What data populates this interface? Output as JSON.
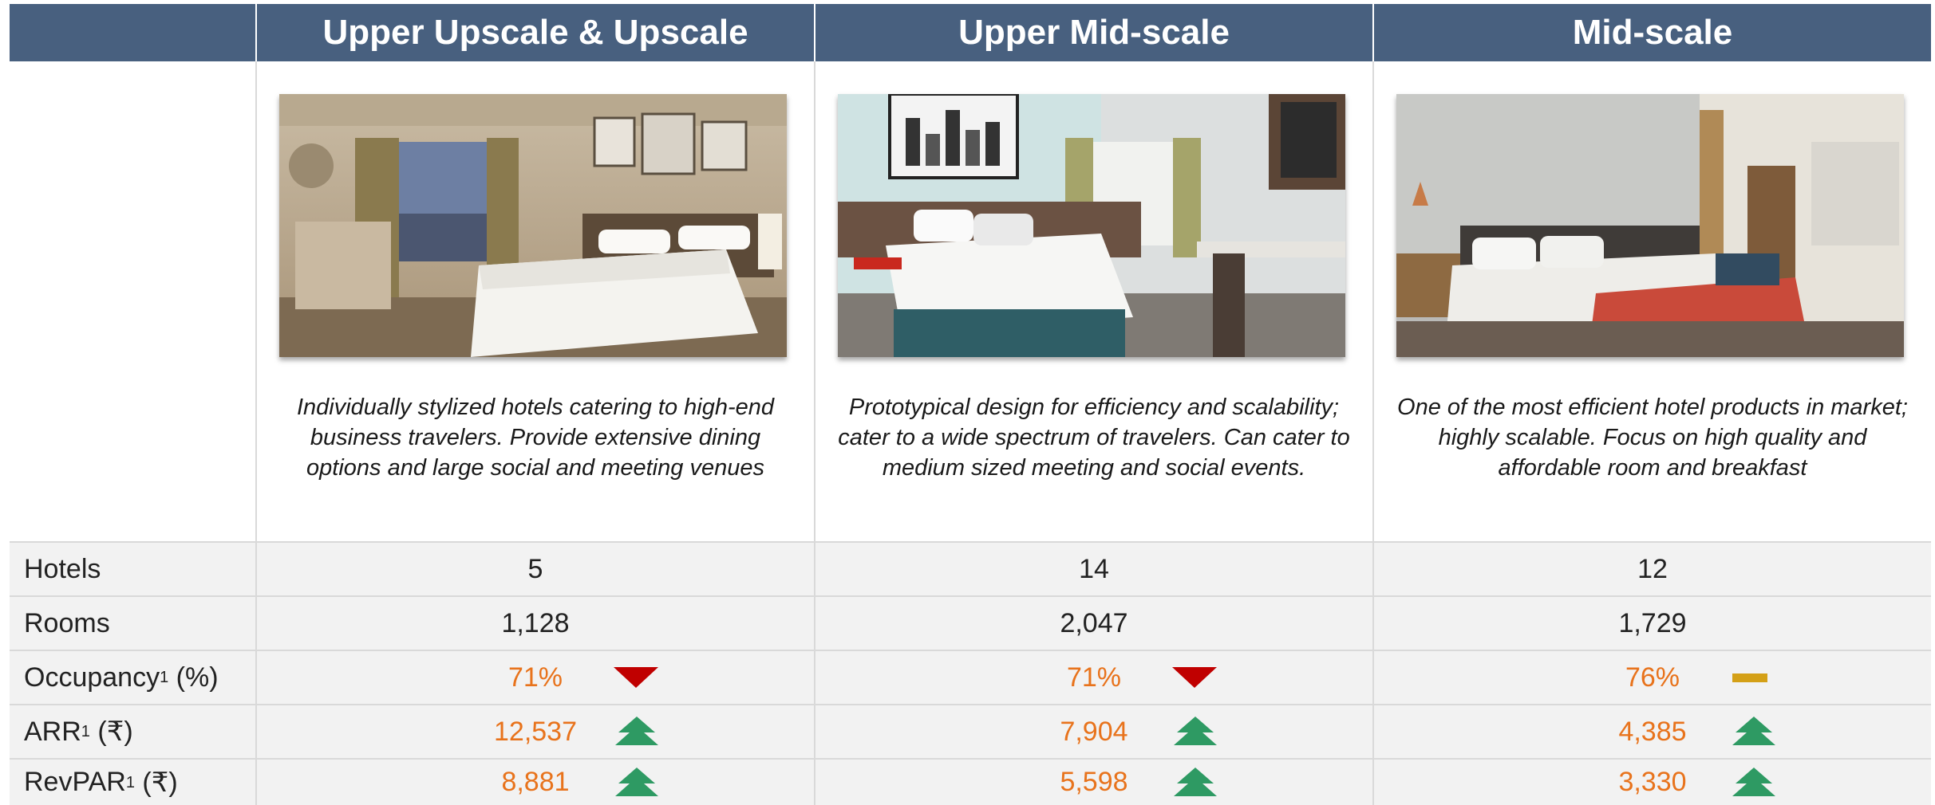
{
  "headers": [
    "Upper Upscale & Upscale",
    "Upper Mid-scale",
    "Mid-scale"
  ],
  "segments": [
    {
      "description": "Individually stylized hotels catering to high-end business travelers. Provide extensive dining options and large social and meeting venues",
      "hotels": "5",
      "rooms": "1,128",
      "occupancy": "71%",
      "arr": "12,537",
      "revpar": "8,881",
      "occupancy_trend": "down",
      "arr_trend": "up",
      "revpar_trend": "up"
    },
    {
      "description": "Prototypical design for efficiency and scalability; cater to a wide spectrum of travelers. Can cater to medium sized meeting and social events.",
      "hotels": "14",
      "rooms": "2,047",
      "occupancy": "71%",
      "arr": "7,904",
      "revpar": "5,598",
      "occupancy_trend": "down",
      "arr_trend": "up",
      "revpar_trend": "up"
    },
    {
      "description": "One of the most efficient hotel products in market; highly scalable. Focus on high quality and affordable room and breakfast",
      "hotels": "12",
      "rooms": "1,729",
      "occupancy": "76%",
      "arr": "4,385",
      "revpar": "3,330",
      "occupancy_trend": "flat",
      "arr_trend": "up",
      "revpar_trend": "up"
    }
  ],
  "row_labels": {
    "hotels": "Hotels",
    "rooms": "Rooms",
    "occupancy": "Occupancy",
    "occupancy_sup": "1",
    "occupancy_unit": " (%)",
    "arr": "ARR",
    "arr_sup": "1",
    "arr_unit": " (₹)",
    "revpar": "RevPAR",
    "revpar_sup": "1",
    "revpar_unit": " (₹)"
  },
  "colors": {
    "header_bg": "#48607f",
    "value_orange": "#e8731c",
    "down_red": "#c00000",
    "up_green": "#2e9a63",
    "flat_gold": "#d4a017"
  }
}
